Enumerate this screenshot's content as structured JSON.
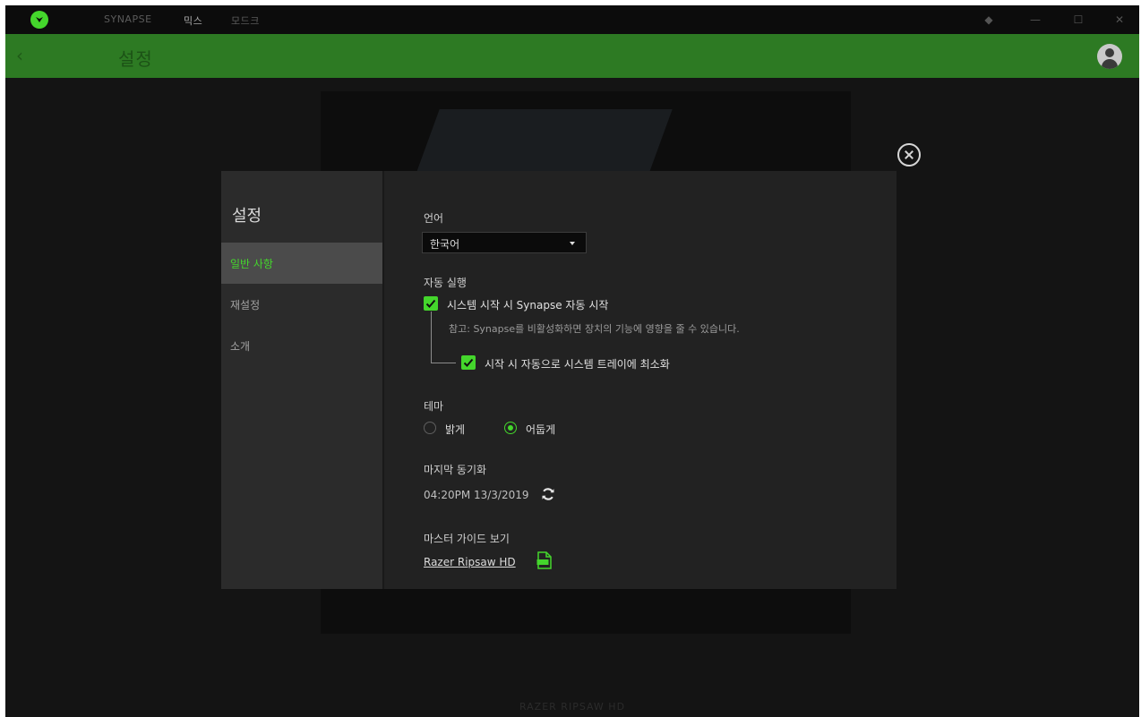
{
  "titlebar": {
    "nav": [
      "SYNAPSE",
      "믹스",
      "모드크"
    ],
    "active_index": 1
  },
  "header": {
    "title": "설정"
  },
  "background": {
    "device_name": "RAZER RIPSAW HD"
  },
  "dialog": {
    "title": "설정",
    "sidebar": {
      "items": [
        {
          "label": "일반 사항",
          "active": true
        },
        {
          "label": "재설정",
          "active": false
        },
        {
          "label": "소개",
          "active": false
        }
      ]
    },
    "language": {
      "label": "언어",
      "value": "한국어"
    },
    "autostart": {
      "label": "자동 실행",
      "start_synapse": {
        "label": "시스템 시작 시 Synapse 자동 시작",
        "checked": true
      },
      "note": "참고: Synapse를 비활성화하면 장치의 기능에 영향을 줄 수 있습니다.",
      "minimize_tray": {
        "label": "시작 시 자동으로 시스템 트레이에 최소화",
        "checked": true
      }
    },
    "theme": {
      "label": "테마",
      "options": [
        "밝게",
        "어둡게"
      ],
      "selected": "어둡게"
    },
    "last_sync": {
      "label": "마지막 동기화",
      "value": "04:20PM 13/3/2019"
    },
    "master_guide": {
      "label": "마스터 가이드 보기",
      "link": "Razer Ripsaw HD"
    }
  },
  "colors": {
    "accent": "#44d62c",
    "header_bg": "#2d7a23",
    "dialog_bg": "#222222"
  },
  "icons": [
    "razer-logo-icon",
    "back-arrow-icon",
    "avatar-icon",
    "close-icon",
    "chevron-down-icon",
    "check-icon",
    "refresh-icon",
    "pdf-icon"
  ]
}
